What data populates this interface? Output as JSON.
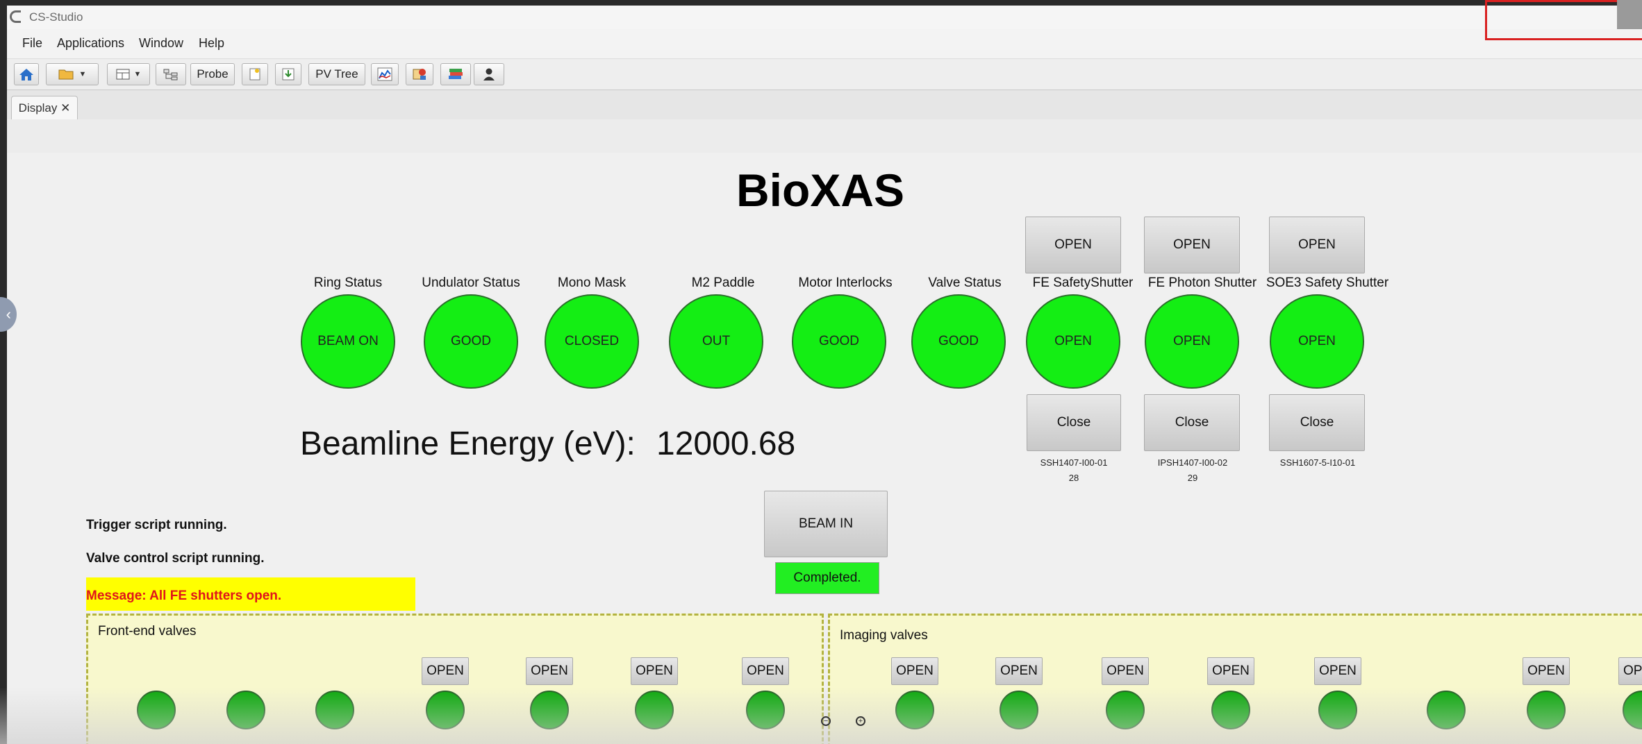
{
  "app": {
    "title": "CS-Studio"
  },
  "menu": [
    "File",
    "Applications",
    "Window",
    "Help"
  ],
  "toolbar": {
    "probe_label": "Probe",
    "pvtree_label": "PV Tree"
  },
  "tabs": [
    {
      "label": "Display ✕"
    }
  ],
  "display": {
    "title": "BioXAS",
    "status": [
      {
        "label": "Ring Status",
        "value": "BEAM ON"
      },
      {
        "label": "Undulator Status",
        "value": "GOOD"
      },
      {
        "label": "Mono Mask",
        "value": "CLOSED"
      },
      {
        "label": "M2 Paddle",
        "value": "OUT"
      },
      {
        "label": "Motor Interlocks",
        "value": "GOOD"
      },
      {
        "label": "Valve Status",
        "value": "GOOD"
      },
      {
        "label": "FE SafetyShutter",
        "value": "OPEN"
      },
      {
        "label": "FE Photon Shutter",
        "value": "OPEN"
      },
      {
        "label": "SOE3 Safety Shutter",
        "value": "OPEN"
      }
    ],
    "shutters": [
      {
        "open": "OPEN",
        "close": "Close",
        "id": "SSH1407-I00-01",
        "num": "28"
      },
      {
        "open": "OPEN",
        "close": "Close",
        "id": "IPSH1407-I00-02",
        "num": "29"
      },
      {
        "open": "OPEN",
        "close": "Close",
        "id": "SSH1607-5-I10-01",
        "num": ""
      }
    ],
    "energy_label": "Beamline Energy (eV):",
    "energy_value": "12000.68",
    "scripts": [
      "Trigger script running.",
      "Valve control script running."
    ],
    "message": "Message: All FE shutters open.",
    "beam_button": "BEAM IN",
    "beam_status": "Completed.",
    "fe_panel": {
      "title": "Front-end valves",
      "open_label": "OPEN"
    },
    "img_panel": {
      "title": "Imaging valves",
      "open_label": "OPEN",
      "cut_label": "OPE"
    }
  },
  "colors": {
    "led_on": "#14ee14",
    "message_bg": "#ffff00",
    "message_text": "#e0151b",
    "panel_bg": "#f8f8cd",
    "panel_border": "#b3b340"
  }
}
